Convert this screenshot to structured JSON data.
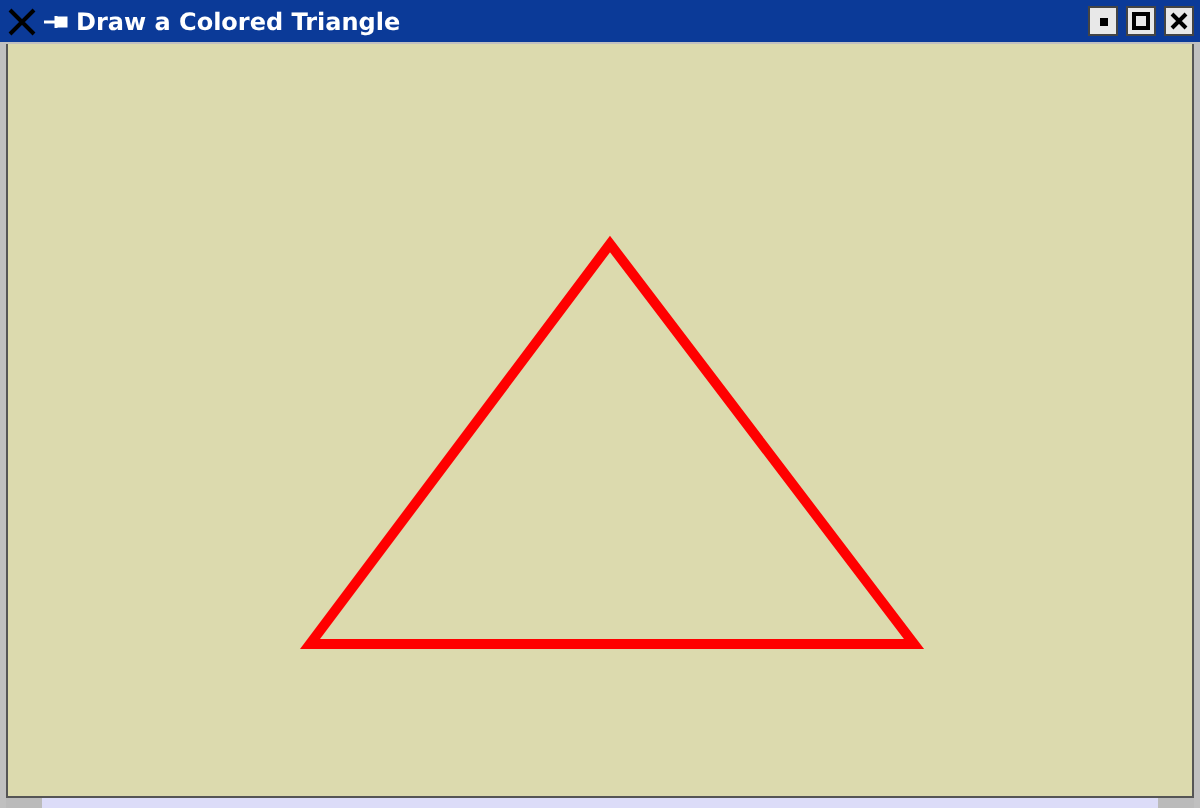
{
  "window": {
    "title": "Draw a Colored Triangle"
  }
}
